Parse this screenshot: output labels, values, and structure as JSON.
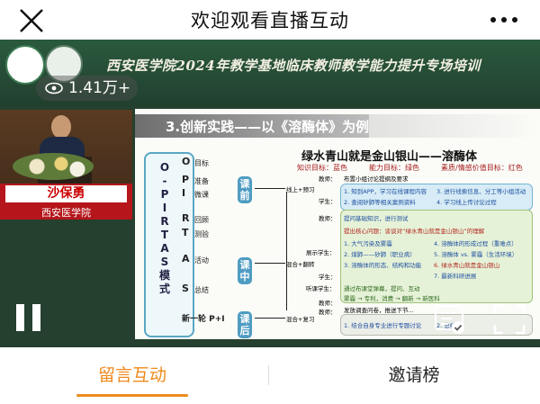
{
  "header": {
    "title": "欢迎观看直播互动",
    "close_icon": "close-icon",
    "more_icon": "more-dots-icon"
  },
  "video": {
    "banner_title": "西安医学院2024年教学基地临床教师教学能力提升专场培训",
    "viewer_count": "1.41万+",
    "speaker_name": "沙保勇",
    "speaker_school": "西安医学院",
    "slide": {
      "heading_num": "3.",
      "heading": "创新实践——以《溶酶体》为例",
      "sub_title": "绿水青山就是金山银山——溶酶体",
      "targets": "知识目标：蓝色　　　能力目标：绿色　　　素质/情感价值目标：红色",
      "model_letters": [
        "O",
        "-",
        "P",
        "I",
        "R",
        "T",
        "A",
        "S",
        "模",
        "式"
      ],
      "rows": [
        {
          "letter": "O",
          "label": "目标"
        },
        {
          "letter": "P",
          "label": "准备"
        },
        {
          "letter": "I",
          "label": "微课"
        },
        {
          "letter": "R",
          "label": "回顾"
        },
        {
          "letter": "T",
          "label": "测验"
        },
        {
          "letter": "A",
          "label": "活动"
        },
        {
          "letter": "S",
          "label": "总结"
        },
        {
          "letter": "新一轮 P+I",
          "label": ""
        }
      ],
      "phases": [
        "课前",
        "课中",
        "课后"
      ],
      "flows": [
        "线上+预习",
        "混合+翻转",
        "混合+复习"
      ],
      "roles": [
        "教师：",
        "学生：",
        "教师：",
        "学生：",
        "教师："
      ],
      "pre_title": "布置小组讨论提纲及要求",
      "pre_items": [
        "1. 知到APP，学习在线课程内容",
        "2. 查阅矽肺等相关案例资料",
        "3. 进行线索信息、分工等小组活动",
        "4. 学习线上传讨论过程"
      ],
      "in_items": [
        "提问基础知识，进行测试",
        "提出核心问题：谈谈对“绿水青山就是金山银山”的理解",
        "1. 大气污染及雾霾",
        "2. 煤肺——矽肺（职业病）",
        "3. 溶酶体的形态、结构和功能",
        "4. 溶酶体的形成过程（重难点）",
        "5. 溶酶体 vs. 雾霾（生活环境）",
        "6. 绿水青山就是金山银山",
        "7. 最新科研进展",
        "展示学生：",
        "听课学生：",
        "教师：",
        "通过布课堂弹幕，提问、互动",
        "雾霾 → 专利，消费 → 翻新 → 新医科"
      ],
      "post_items": [
        "发放调查问卷，推送下节...",
        "1. 结合自身专业进行专题讨论",
        "2. 总结..."
      ]
    }
  },
  "controls": {
    "pause_icon": "pause-icon",
    "playlist_icon": "playlist-icon",
    "fullscreen_icon": "fullscreen-icon"
  },
  "tabs": {
    "active": "留言互动",
    "inactive": "邀请榜"
  },
  "colors": {
    "accent": "#ee8a1c",
    "name_card": "#b5151b"
  }
}
